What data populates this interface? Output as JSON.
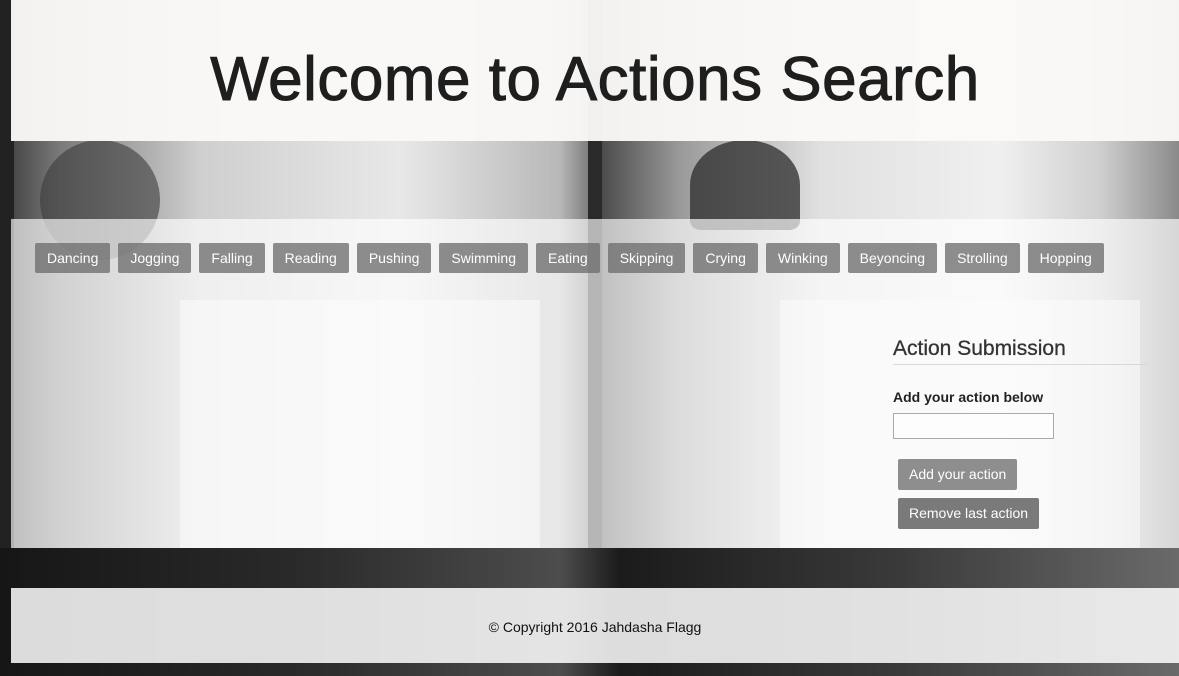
{
  "header": {
    "title": "Welcome to Actions Search"
  },
  "actions": [
    {
      "label": "Dancing"
    },
    {
      "label": "Jogging"
    },
    {
      "label": "Falling"
    },
    {
      "label": "Reading"
    },
    {
      "label": "Pushing"
    },
    {
      "label": "Swimming"
    },
    {
      "label": "Eating"
    },
    {
      "label": "Skipping"
    },
    {
      "label": "Crying"
    },
    {
      "label": "Winking"
    },
    {
      "label": "Beyoncing"
    },
    {
      "label": "Strolling"
    },
    {
      "label": "Hopping"
    }
  ],
  "submission": {
    "heading": "Action Submission",
    "field_label": "Add your action below",
    "input_value": "",
    "add_button": "Add your action",
    "remove_button": "Remove last action"
  },
  "footer": {
    "copyright": "© Copyright 2016 Jahdasha Flagg"
  },
  "colors": {
    "action_button_bg": "#6e6e6e",
    "submit_button_bg": "#8e8e8e",
    "title_text": "#1e1e1e"
  }
}
